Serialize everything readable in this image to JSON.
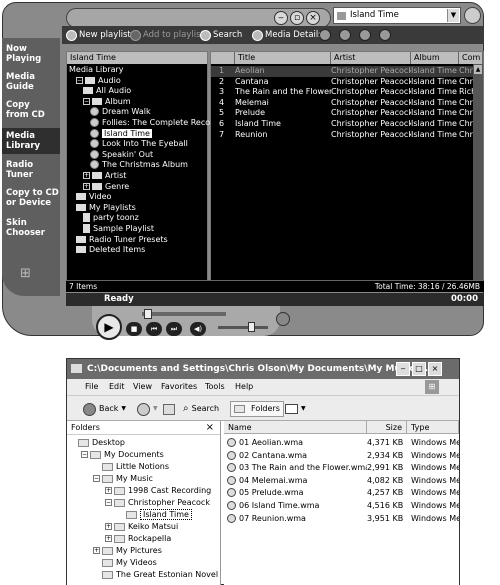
{
  "wmp": {
    "taskbar": [
      "Now\nPlaying",
      "Media\nGuide",
      "Copy\nfrom CD",
      "Media\nLibrary",
      "Radio\nTuner",
      "Copy to CD\nor Device",
      "Skin\nChooser"
    ],
    "selected_playlist": "Island Time",
    "toolbar": {
      "new_playlist": "New playlist",
      "add_to_playlist": "Add to playlist",
      "search": "Search",
      "media_details": "Media Details"
    },
    "library_header": "Island Time",
    "tree": [
      {
        "label": "Media Library",
        "level": 0,
        "toggle": "",
        "icon": ""
      },
      {
        "label": "Audio",
        "level": 1,
        "toggle": "−",
        "icon": "folder"
      },
      {
        "label": "All Audio",
        "level": 2,
        "toggle": "",
        "icon": "folder"
      },
      {
        "label": "Album",
        "level": 2,
        "toggle": "−",
        "icon": "folder"
      },
      {
        "label": "Dream Walk",
        "level": 3,
        "toggle": "",
        "icon": "disc"
      },
      {
        "label": "Follies: The Complete Reco",
        "level": 3,
        "toggle": "",
        "icon": "disc"
      },
      {
        "label": "Island Time",
        "level": 3,
        "toggle": "",
        "icon": "disc",
        "selected": true
      },
      {
        "label": "Look Into The Eyeball",
        "level": 3,
        "toggle": "",
        "icon": "disc"
      },
      {
        "label": "Speakin' Out",
        "level": 3,
        "toggle": "",
        "icon": "disc"
      },
      {
        "label": "The Christmas Album",
        "level": 3,
        "toggle": "",
        "icon": "disc"
      },
      {
        "label": "Artist",
        "level": 2,
        "toggle": "+",
        "icon": "folder"
      },
      {
        "label": "Genre",
        "level": 2,
        "toggle": "+",
        "icon": "folder"
      },
      {
        "label": "Video",
        "level": 1,
        "toggle": "",
        "icon": "folder"
      },
      {
        "label": "My Playlists",
        "level": 1,
        "toggle": "",
        "icon": "folder"
      },
      {
        "label": "party toonz",
        "level": 2,
        "toggle": "",
        "icon": "doc"
      },
      {
        "label": "Sample Playlist",
        "level": 2,
        "toggle": "",
        "icon": "doc"
      },
      {
        "label": "Radio Tuner Presets",
        "level": 1,
        "toggle": "",
        "icon": "folder"
      },
      {
        "label": "Deleted Items",
        "level": 1,
        "toggle": "",
        "icon": "folder"
      }
    ],
    "columns": [
      "Title",
      "Artist",
      "Album",
      "Com"
    ],
    "tracks": [
      {
        "n": "1",
        "title": "Aeolian",
        "artist": "Christopher Peacock",
        "album": "Island Time",
        "com": "Chris"
      },
      {
        "n": "2",
        "title": "Cantana",
        "artist": "Christopher Peacock",
        "album": "Island Time",
        "com": "Chris"
      },
      {
        "n": "3",
        "title": "The Rain and the Flower",
        "artist": "Christopher Peacock",
        "album": "Island Time",
        "com": "Richa"
      },
      {
        "n": "4",
        "title": "Melemai",
        "artist": "Christopher Peacock",
        "album": "Island Time",
        "com": "Chris"
      },
      {
        "n": "5",
        "title": "Prelude",
        "artist": "Christopher Peacock",
        "album": "Island Time",
        "com": "Chris"
      },
      {
        "n": "6",
        "title": "Island Time",
        "artist": "Christopher Peacock",
        "album": "Island Time",
        "com": "Chris"
      },
      {
        "n": "7",
        "title": "Reunion",
        "artist": "Christopher Peacock",
        "album": "Island Time",
        "com": "Chris"
      }
    ],
    "items_count": "7 Items",
    "total_time": "Total Time: 38:16 / 26.46MB",
    "status": "Ready",
    "time": "00:00"
  },
  "explorer": {
    "title": "C:\\Documents and Settings\\Chris Olson\\My Documents\\My Music\\...",
    "menu": [
      "File",
      "Edit",
      "View",
      "Favorites",
      "Tools",
      "Help"
    ],
    "back": "Back",
    "search": "Search",
    "folders_btn": "Folders",
    "folders_header": "Folders",
    "close_x": "×",
    "tree": [
      {
        "label": "Desktop",
        "level": 0,
        "toggle": ""
      },
      {
        "label": "My Documents",
        "level": 1,
        "toggle": "−"
      },
      {
        "label": "Little Notions",
        "level": 2,
        "toggle": ""
      },
      {
        "label": "My Music",
        "level": 2,
        "toggle": "−"
      },
      {
        "label": "1998 Cast Recording",
        "level": 3,
        "toggle": "+"
      },
      {
        "label": "Christopher Peacock",
        "level": 3,
        "toggle": "−"
      },
      {
        "label": "Island Time",
        "level": 4,
        "toggle": "",
        "selected": true
      },
      {
        "label": "Keiko Matsui",
        "level": 3,
        "toggle": "+"
      },
      {
        "label": "Rockapella",
        "level": 3,
        "toggle": "+"
      },
      {
        "label": "My Pictures",
        "level": 2,
        "toggle": "+"
      },
      {
        "label": "My Videos",
        "level": 2,
        "toggle": ""
      },
      {
        "label": "The Great Estonian Novel",
        "level": 2,
        "toggle": ""
      }
    ],
    "columns": [
      "Name",
      "Size",
      "Type"
    ],
    "files": [
      {
        "name": "01 Aeolian.wma",
        "size": "4,371 KB",
        "type": "Windows Me"
      },
      {
        "name": "02 Cantana.wma",
        "size": "2,934 KB",
        "type": "Windows Me"
      },
      {
        "name": "03 The Rain and the Flower.wma",
        "size": "2,991 KB",
        "type": "Windows Me"
      },
      {
        "name": "04 Melemai.wma",
        "size": "4,082 KB",
        "type": "Windows Me"
      },
      {
        "name": "05 Prelude.wma",
        "size": "4,257 KB",
        "type": "Windows Me"
      },
      {
        "name": "06 Island Time.wma",
        "size": "4,516 KB",
        "type": "Windows Me"
      },
      {
        "name": "07 Reunion.wma",
        "size": "3,951 KB",
        "type": "Windows Me"
      }
    ]
  }
}
